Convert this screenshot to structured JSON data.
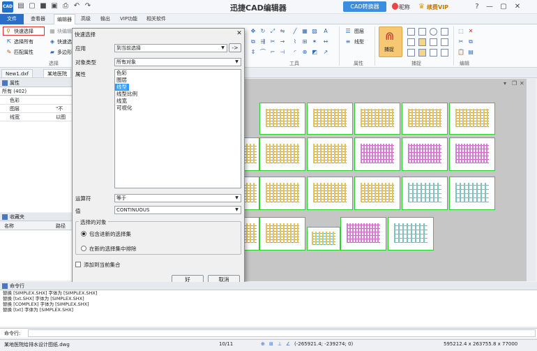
{
  "app": {
    "logo": "CAD",
    "title": "迅捷CAD编辑器",
    "converter": "CAD转换器",
    "nickname": "昵称",
    "vip": "续费VIP"
  },
  "tabs": [
    "文件",
    "查看器",
    "编辑器",
    "高级",
    "输出",
    "VIP功能",
    "相关软件"
  ],
  "ribbon": {
    "select_group": {
      "quick_select": "快速选择",
      "block_edit": "块编辑",
      "select_all": "选择所有",
      "quick_x": "快速选",
      "match_props": "匹配属性",
      "multi_side": "多边形",
      "label": "选择"
    },
    "tools_label": "工具",
    "props": {
      "layer": "图层",
      "linetype": "线型",
      "label": "属性"
    },
    "snap": {
      "button": "捕捉",
      "label": "捕捉"
    },
    "edit_label": "编辑"
  },
  "doc_tabs": [
    "New1.dxf",
    "某地医院"
  ],
  "properties_panel": {
    "title": "属性",
    "filter": "所有 (402)",
    "rows": [
      {
        "name": "色彩",
        "value": ""
      },
      {
        "name": "图层",
        "value": "\"不"
      },
      {
        "name": "线宽",
        "value": "以图"
      }
    ]
  },
  "favorites_panel": {
    "title": "收藏夹",
    "columns": [
      "名称",
      "路径"
    ]
  },
  "dialog": {
    "title": "快速选择",
    "apply_label": "应用",
    "apply_value": "到当前选择",
    "apply_btn": "->",
    "object_type_label": "对象类型",
    "object_type_value": "所有对象",
    "properties_label": "属性",
    "properties": [
      "色彩",
      "图层",
      "线型",
      "线型比例",
      "线宽",
      "可视化"
    ],
    "selected_property": "线型",
    "operator_label": "运算符",
    "operator_value": "等于",
    "value_label": "值",
    "value_value": "CONTINUOUS",
    "selection_group_title": "选择的对象",
    "include_option": "包含进新的选择集",
    "exclude_option": "在新的选择集中排除",
    "append_label": "添加到当前集合",
    "ok": "好",
    "cancel": "取消"
  },
  "command": {
    "title": "命令行",
    "history": [
      "替换 [SIMPLEX.SHX] 字体为 [SIMPLEX.SHX]",
      "替换 [txt.SHX] 字体为 [SIMPLEX.SHX]",
      "替换 [COMPLEX] 字体为 [SIMPLEX.SHX]",
      "替换 [txt] 字体为 [SIMPLEX.SHX]"
    ],
    "prompt": "命令行:"
  },
  "status": {
    "filename": "某地医院给排水设计图纸.dwg",
    "page": "10/11",
    "coords": "(-265921.4; -239274; 0)",
    "size": "595212.4 x 263755.8 x 77000"
  },
  "colors": {
    "accent": "#2a6ec8",
    "sheet_border": "#2bd12b",
    "canvas": "#c6c6c6",
    "highlight_red": "#e03030",
    "selection_blue": "#3399ff"
  }
}
